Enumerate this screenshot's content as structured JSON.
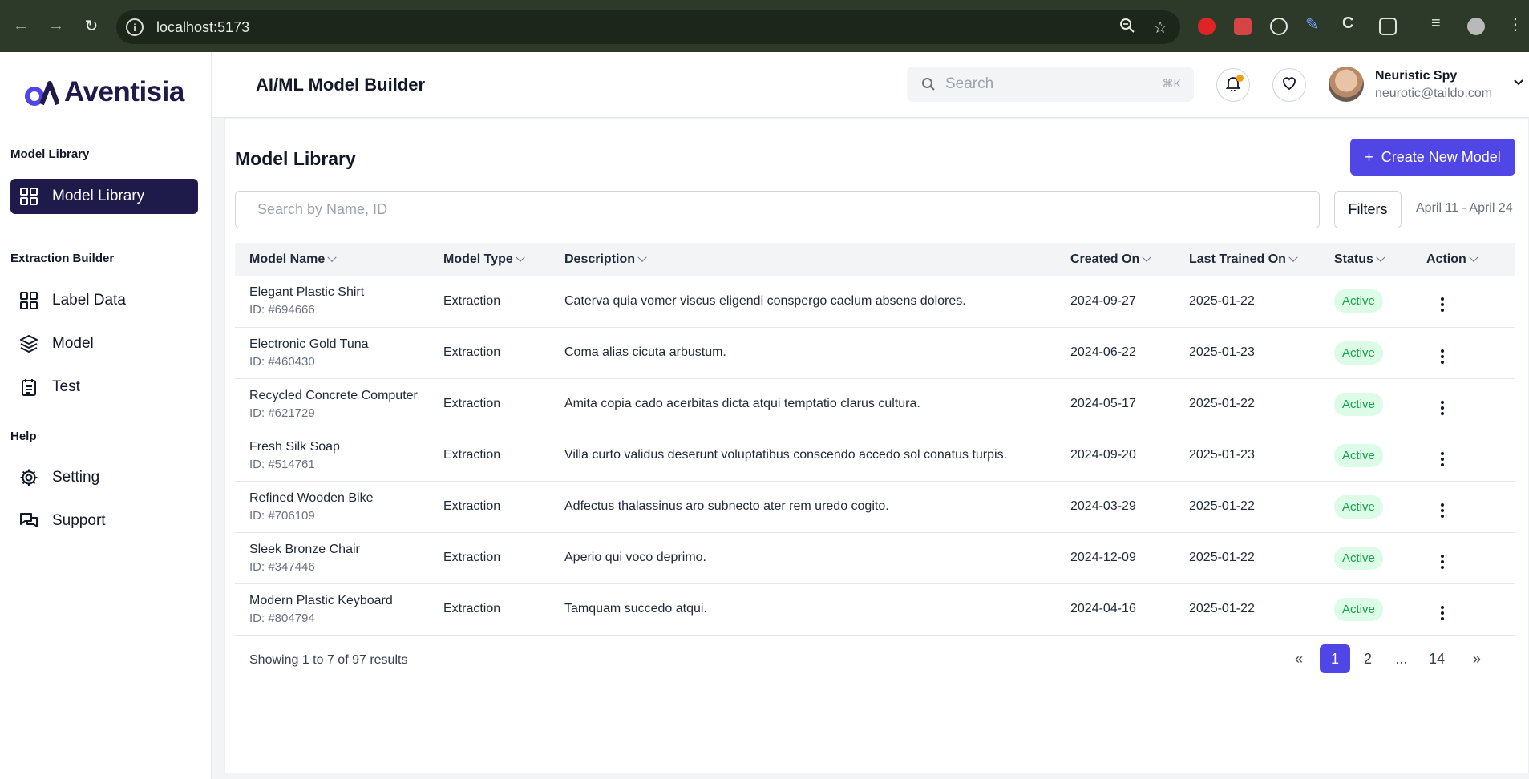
{
  "browser": {
    "url": "localhost:5173",
    "icons": [
      "back-icon",
      "forward-icon",
      "reload-icon",
      "site-info-icon",
      "zoom-icon",
      "bookmark-star-icon",
      "extensions-icon",
      "profile-icon",
      "menu-icon"
    ]
  },
  "brand": {
    "name": "Aventisia",
    "color": "#1e1b4b",
    "accent": "#4f46e5"
  },
  "sidebar": {
    "sections": [
      {
        "title": "Model Library",
        "items": [
          {
            "label": "Model Library",
            "icon": "grid-icon",
            "active": true
          }
        ]
      },
      {
        "title": "Extraction Builder",
        "items": [
          {
            "label": "Label Data",
            "icon": "grid-icon"
          },
          {
            "label": "Model",
            "icon": "layers-icon"
          },
          {
            "label": "Test",
            "icon": "clipboard-icon"
          }
        ]
      },
      {
        "title": "Help",
        "items": [
          {
            "label": "Setting",
            "icon": "gear-icon"
          },
          {
            "label": "Support",
            "icon": "chat-icon"
          }
        ]
      }
    ]
  },
  "header": {
    "title": "AI/ML Model Builder",
    "search_placeholder": "Search",
    "search_shortcut": "⌘K",
    "user": {
      "name": "Neuristic Spy",
      "email": "neurotic@taildo.com"
    }
  },
  "main": {
    "title": "Model Library",
    "create_label": "Create New Model",
    "create_plus": "+",
    "search_placeholder": "Search by Name, ID",
    "filters_label": "Filters",
    "date_range": "April 11 - April 24",
    "columns": [
      "Model Name",
      "Model Type",
      "Description",
      "Created On",
      "Last Trained On",
      "Status",
      "Action"
    ],
    "rows": [
      {
        "name": "Elegant Plastic Shirt",
        "id": "ID: #694666",
        "type": "Extraction",
        "description": "Caterva quia vomer viscus eligendi conspergo caelum absens dolores.",
        "created": "2024-09-27",
        "trained": "2025-01-22",
        "status": "Active"
      },
      {
        "name": "Electronic Gold Tuna",
        "id": "ID: #460430",
        "type": "Extraction",
        "description": "Coma alias cicuta arbustum.",
        "created": "2024-06-22",
        "trained": "2025-01-23",
        "status": "Active"
      },
      {
        "name": "Recycled Concrete Computer",
        "id": "ID: #621729",
        "type": "Extraction",
        "description": "Amita copia cado acerbitas dicta atqui temptatio clarus cultura.",
        "created": "2024-05-17",
        "trained": "2025-01-22",
        "status": "Active"
      },
      {
        "name": "Fresh Silk Soap",
        "id": "ID: #514761",
        "type": "Extraction",
        "description": "Villa curto validus deserunt voluptatibus conscendo accedo sol conatus turpis.",
        "created": "2024-09-20",
        "trained": "2025-01-23",
        "status": "Active"
      },
      {
        "name": "Refined Wooden Bike",
        "id": "ID: #706109",
        "type": "Extraction",
        "description": "Adfectus thalassinus aro subnecto ater rem uredo cogito.",
        "created": "2024-03-29",
        "trained": "2025-01-22",
        "status": "Active"
      },
      {
        "name": "Sleek Bronze Chair",
        "id": "ID: #347446",
        "type": "Extraction",
        "description": "Aperio qui voco deprimo.",
        "created": "2024-12-09",
        "trained": "2025-01-22",
        "status": "Active"
      },
      {
        "name": "Modern Plastic Keyboard",
        "id": "ID: #804794",
        "type": "Extraction",
        "description": "Tamquam succedo atqui.",
        "created": "2024-04-16",
        "trained": "2025-01-22",
        "status": "Active"
      }
    ],
    "showing": "Showing 1 to 7 of 97 results",
    "pagination": {
      "first": "«",
      "pages": [
        "1",
        "2",
        "...",
        "14"
      ],
      "last": "»",
      "current": "1"
    }
  }
}
